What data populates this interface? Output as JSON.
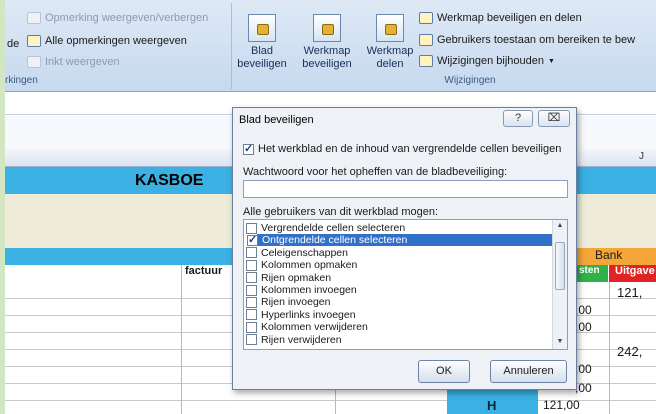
{
  "ribbon": {
    "comments": {
      "show_hide_comment": "Opmerking weergeven/verbergen",
      "show_all_comments": "Alle opmerkingen weergeven",
      "show_ink": "Inkt weergeven",
      "cut_label_left": "de",
      "group_label_partial": "rkingen"
    },
    "changes": {
      "protect_sheet": "Blad beveiligen",
      "protect_workbook": "Werkmap beveiligen",
      "share_workbook": "Werkmap delen",
      "protect_and_share": "Werkmap beveiligen en delen",
      "allow_ranges": "Gebruikers toestaan om bereiken te bew",
      "track_changes": "Wijzigingen bijhouden",
      "group_label": "Wijzigingen"
    }
  },
  "sheet": {
    "column_j": "J",
    "title_partial": "KASBOE",
    "factuur_partial": "factuur",
    "bank_header": "Bank",
    "ontvangsten_partial": "sten",
    "uitgaven_partial": "Uitgave",
    "values_right": [
      "121,",
      "242,"
    ],
    "values_col": [
      ",00",
      ",00",
      ",00",
      ",00",
      "121,00"
    ],
    "letter_h": "H"
  },
  "dialog": {
    "title": "Blad beveiligen",
    "help_button": "?",
    "close_button": "⌧",
    "protect_checkbox_label": "Het werkblad en de inhoud van vergrendelde cellen beveiligen",
    "protect_checked": true,
    "password_label": "Wachtwoord voor het opheffen van de bladbeveiliging:",
    "password_value": "",
    "list_label": "Alle gebruikers van dit werkblad mogen:",
    "permissions": [
      {
        "label": "Vergrendelde cellen selecteren",
        "checked": false
      },
      {
        "label": "Ontgrendelde cellen selecteren",
        "checked": true
      },
      {
        "label": "Celeigenschappen",
        "checked": false
      },
      {
        "label": "Kolommen opmaken",
        "checked": false
      },
      {
        "label": "Rijen opmaken",
        "checked": false
      },
      {
        "label": "Kolommen invoegen",
        "checked": false
      },
      {
        "label": "Rijen invoegen",
        "checked": false
      },
      {
        "label": "Hyperlinks invoegen",
        "checked": false
      },
      {
        "label": "Kolommen verwijderen",
        "checked": false
      },
      {
        "label": "Rijen verwijderen",
        "checked": false
      }
    ],
    "ok_label": "OK",
    "cancel_label": "Annuleren"
  },
  "colors": {
    "selection": "#3170c8",
    "header_blue": "#3ab0e3",
    "bank_orange": "#f5a638",
    "green_tab": "#2fb24a",
    "red_tab": "#e02424"
  }
}
